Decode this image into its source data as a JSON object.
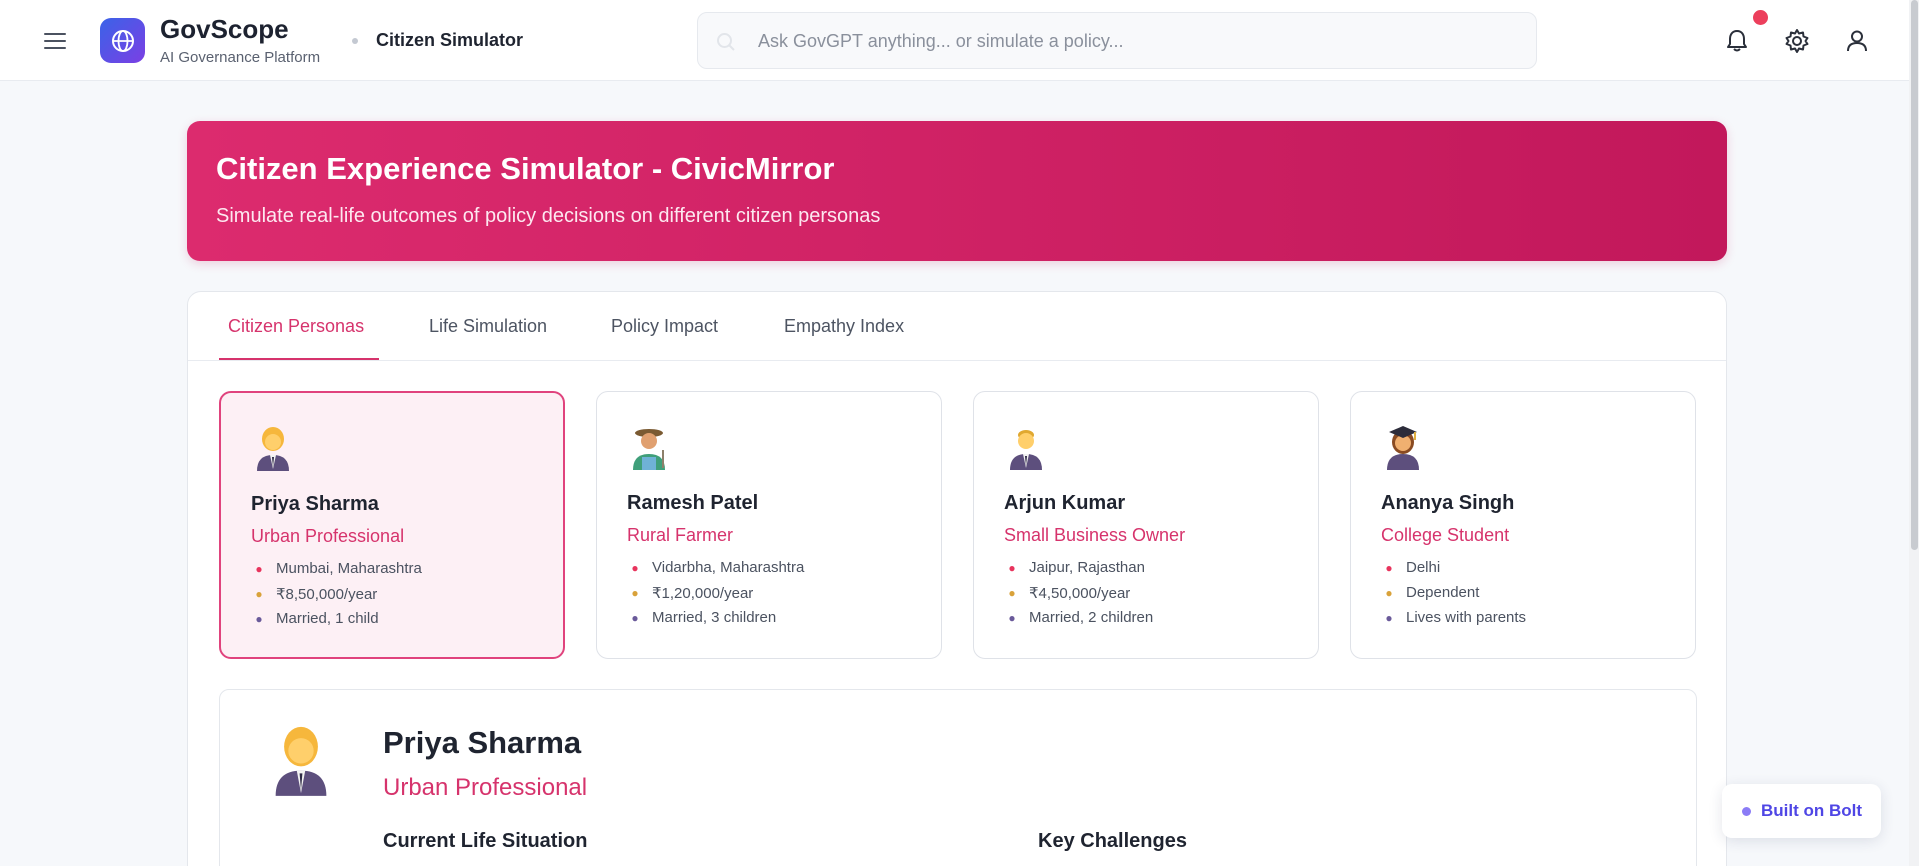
{
  "header": {
    "brand_name": "GovScope",
    "brand_subtitle": "AI Governance Platform",
    "breadcrumb_page": "Citizen Simulator",
    "search_placeholder": "Ask GovGPT anything... or simulate a policy...",
    "search_value": "",
    "icons": [
      "menu-icon",
      "globe-icon",
      "search-icon",
      "bell-icon",
      "gear-icon",
      "user-icon"
    ],
    "notification_color": "#ec3f5c"
  },
  "banner": {
    "title": "Citizen Experience Simulator - CivicMirror",
    "subtitle": "Simulate real-life outcomes of policy decisions on different citizen personas",
    "gradient": [
      "#dc2b6e",
      "#c2185b"
    ]
  },
  "tabs": [
    {
      "label": "Citizen Personas",
      "active": true
    },
    {
      "label": "Life Simulation",
      "active": false
    },
    {
      "label": "Policy Impact",
      "active": false
    },
    {
      "label": "Empathy Index",
      "active": false
    }
  ],
  "personas": [
    {
      "name": "Priya Sharma",
      "role": "Urban Professional",
      "location": "Mumbai, Maharashtra",
      "income": "₹8,50,000/year",
      "family": "Married, 1 child",
      "avatar": "businesswoman-icon",
      "selected": true
    },
    {
      "name": "Ramesh Patel",
      "role": "Rural Farmer",
      "location": "Vidarbha, Maharashtra",
      "income": "₹1,20,000/year",
      "family": "Married, 3 children",
      "avatar": "farmer-icon",
      "selected": false
    },
    {
      "name": "Arjun Kumar",
      "role": "Small Business Owner",
      "location": "Jaipur, Rajasthan",
      "income": "₹4,50,000/year",
      "family": "Married, 2 children",
      "avatar": "businessman-icon",
      "selected": false
    },
    {
      "name": "Ananya Singh",
      "role": "College Student",
      "location": "Delhi",
      "income": "Dependent",
      "family": "Lives with parents",
      "avatar": "student-icon",
      "selected": false
    }
  ],
  "detail": {
    "name": "Priya Sharma",
    "role": "Urban Professional",
    "current_heading": "Current Life Situation",
    "challenges_heading": "Key Challenges"
  },
  "bolt_badge": {
    "label": "Built on Bolt"
  },
  "colors": {
    "accent": "#d6336c",
    "selected_bg": "#fdf0f5",
    "bolt": "#4f46e5"
  }
}
